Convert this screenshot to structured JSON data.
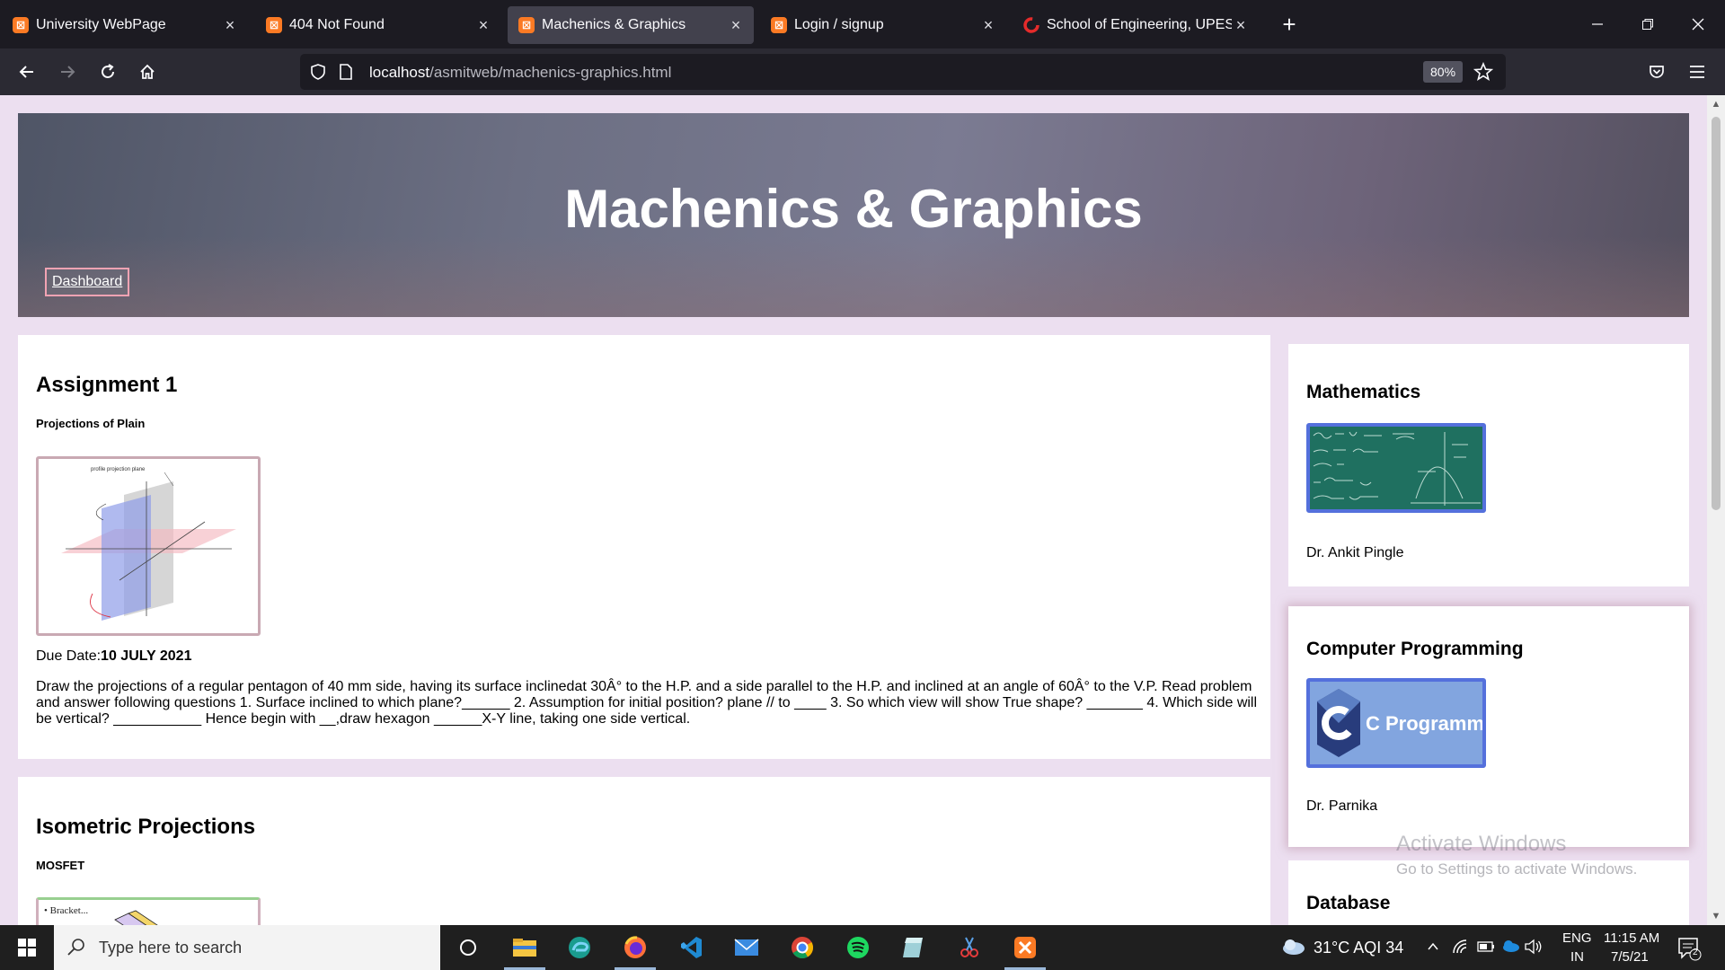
{
  "browser": {
    "tabs": [
      {
        "title": "University WebPage",
        "favicon": "xampp"
      },
      {
        "title": "404 Not Found",
        "favicon": "xampp"
      },
      {
        "title": "Machenics & Graphics",
        "favicon": "xampp",
        "active": true
      },
      {
        "title": "Login / signup",
        "favicon": "xampp"
      },
      {
        "title": "School of Engineering, UPES De",
        "favicon": "upes"
      }
    ],
    "url_host": "localhost",
    "url_path": "/asmitweb/machenics-graphics.html",
    "zoom": "80%"
  },
  "page": {
    "hero_title": "Machenics & Graphics",
    "dashboard_label": "Dashboard",
    "assignments": [
      {
        "title": "Assignment 1",
        "subtitle": "Projections of Plain",
        "image_label": "profile projection plane",
        "due_label": "Due Date:",
        "due_date": "10 JULY 2021",
        "description": "Draw the projections of a regular pentagon of 40 mm side, having its surface inclinedat 30Â° to the H.P. and a side parallel to the H.P. and inclined at an angle of 60Â° to the V.P. Read problem and answer following questions 1. Surface inclined to which plane?______ 2. Assumption for initial position? plane // to ____ 3. So which view will show True shape? _______ 4. Which side will be vertical? ___________ Hence begin with __,draw hexagon ______X-Y line, taking one side vertical."
      },
      {
        "title": "Isometric Projections",
        "subtitle": "MOSFET",
        "image_label": "Bracket..."
      }
    ],
    "subjects": [
      {
        "name": "Mathematics",
        "professor": "Dr. Ankit Pingle"
      },
      {
        "name": "Computer Programming",
        "professor": "Dr. Parnika",
        "thumb_text": "C Programming"
      },
      {
        "name": "Database"
      }
    ],
    "watermark_title": "Activate Windows",
    "watermark_sub": "Go to Settings to activate Windows."
  },
  "taskbar": {
    "search_placeholder": "Type here to search",
    "weather": "31°C  AQI 34",
    "lang_line1": "ENG",
    "lang_line2": "IN",
    "time": "11:15 AM",
    "date": "7/5/21",
    "notifications": "2"
  },
  "colors": {
    "accent_border": "#5470dc",
    "dashboard_border": "#f2a3b3",
    "page_bg": "#ecdff0"
  }
}
